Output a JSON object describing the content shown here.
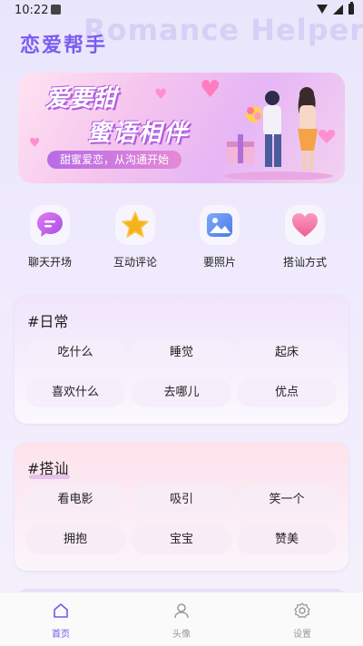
{
  "status_bar": {
    "time": "10:22"
  },
  "header": {
    "title": "恋爱帮手",
    "bg_text": "Romance Helper"
  },
  "banner": {
    "line1": "爱要甜",
    "line2": "蜜语相伴",
    "slogan": "甜蜜爱恋，从沟通开始"
  },
  "quick_actions": [
    {
      "label": "聊天开场",
      "icon": "chat-bubble-icon",
      "color": "#c74fe6"
    },
    {
      "label": "互动评论",
      "icon": "star-icon",
      "color": "#f6b21a"
    },
    {
      "label": "要照片",
      "icon": "image-icon",
      "color": "#5b8ff5"
    },
    {
      "label": "搭讪方式",
      "icon": "heart-icon",
      "color": "#f27aa8"
    }
  ],
  "sections": [
    {
      "title": "#日常",
      "chips": [
        "吃什么",
        "睡觉",
        "起床",
        "喜欢什么",
        "去哪儿",
        "优点"
      ]
    },
    {
      "title": "#搭讪",
      "chips": [
        "看电影",
        "吸引",
        "笑一个",
        "拥抱",
        "宝宝",
        "赞美"
      ]
    }
  ],
  "tabs": [
    {
      "label": "首页",
      "icon": "home-icon",
      "active": true
    },
    {
      "label": "头像",
      "icon": "user-icon",
      "active": false
    },
    {
      "label": "设置",
      "icon": "settings-icon",
      "active": false
    }
  ],
  "colors": {
    "accent": "#6b5ce7",
    "title": "#7b5cf0"
  }
}
